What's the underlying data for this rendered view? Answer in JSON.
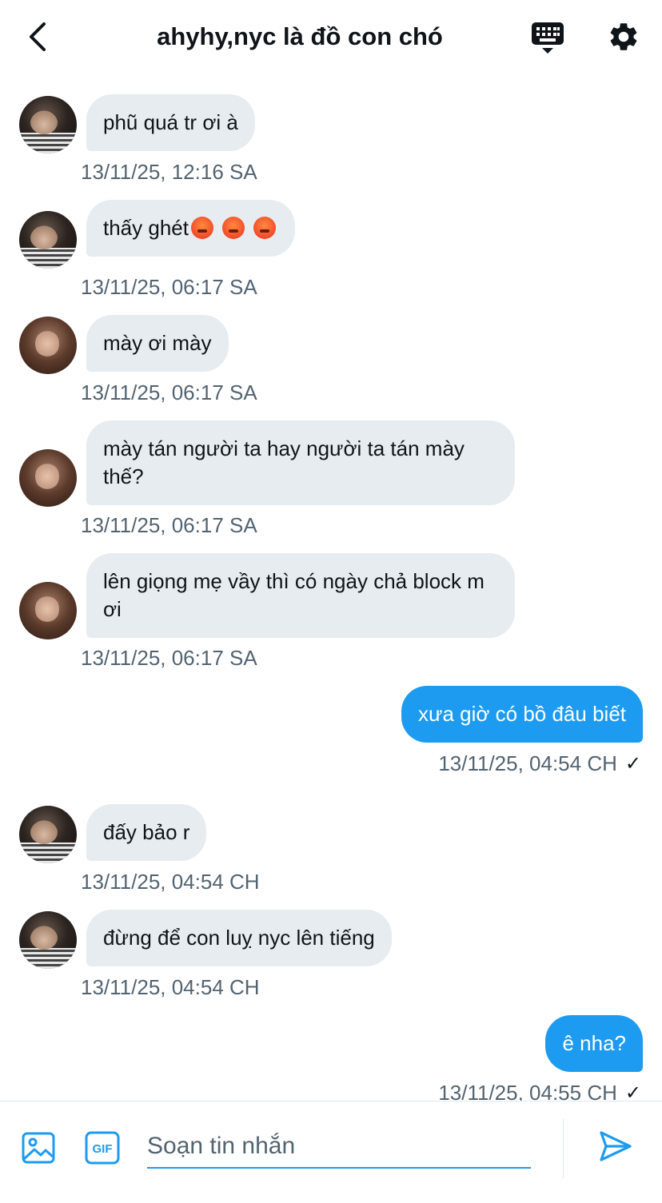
{
  "header": {
    "title": "ahyhy,nyc là đồ con chó"
  },
  "messages": [
    {
      "sender": "male",
      "text": "phũ quá tr ơi à",
      "time": "13/11/25, 12:16 SA"
    },
    {
      "sender": "male",
      "text": "thấy ghét",
      "emoji": [
        "angry-face",
        "angry-face",
        "angry-face"
      ],
      "time": "13/11/25, 06:17 SA"
    },
    {
      "sender": "female",
      "text": "mày ơi mày",
      "time": "13/11/25, 06:17 SA"
    },
    {
      "sender": "female",
      "text": "mày tán người ta hay người ta tán mày thế?",
      "time": "13/11/25, 06:17 SA"
    },
    {
      "sender": "female",
      "text": "lên giọng mẹ vầy thì có ngày chả block m ơi",
      "time": "13/11/25, 06:17 SA"
    },
    {
      "sender": "me",
      "text": "xưa giờ có bồ đâu biết",
      "time": "13/11/25, 04:54 CH",
      "check": "✓"
    },
    {
      "sender": "male",
      "text": "đấy bảo r",
      "time": "13/11/25, 04:54 CH"
    },
    {
      "sender": "male",
      "text": "đừng để con luỵ nyc lên tiếng",
      "time": "13/11/25, 04:54 CH"
    },
    {
      "sender": "me",
      "text": "ê nha?",
      "time": "13/11/25, 04:55 CH",
      "check": "✓"
    }
  ],
  "composer": {
    "placeholder": "Soạn tin nhắn",
    "value": "",
    "gif_label": "GIF"
  },
  "colors": {
    "accent": "#1d9bf0",
    "incoming_bubble": "#e7ecf0",
    "timestamp": "#536471"
  },
  "icons": [
    "back-arrow-icon",
    "keyboard-icon",
    "gear-icon",
    "image-icon",
    "gif-icon",
    "send-icon"
  ]
}
